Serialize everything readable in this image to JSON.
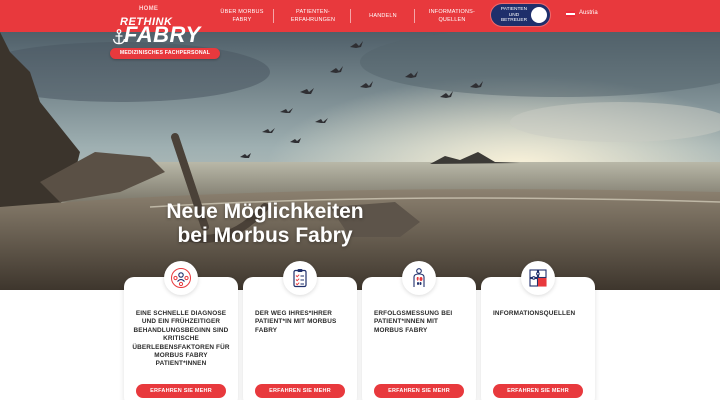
{
  "header": {
    "home_label": "HOME",
    "logo": {
      "top": "RETHINK",
      "main": "FABRY",
      "subtitle": "MEDIZINISCHES FACHPERSONAL"
    },
    "nav": [
      {
        "label": "ÜBER MORBUS\nFABRY"
      },
      {
        "label": "PATIENTEN-\nERFAHRUNGEN"
      },
      {
        "label": "HANDELN"
      },
      {
        "label": "INFORMATIONS-\nQUELLEN"
      }
    ],
    "toggle_label": "PATIENTEN\nUND\nBETREUER",
    "country": "Austria"
  },
  "hero": {
    "title_line1": "Neue Möglichkeiten",
    "title_line2": "bei Morbus Fabry"
  },
  "cards": [
    {
      "icon": "people-network-icon",
      "text": "EINE SCHNELLE DIAGNOSE UND EIN FRÜHZEITIGER BEHANDLUNGSBEGINN SIND KRITISCHE ÜBERLEBENSFAKTOREN FÜR MORBUS FABRY PATIENT*INNEN",
      "button": "ERFAHREN SIE MEHR"
    },
    {
      "icon": "clipboard-checklist-icon",
      "text": "DER WEG IHRES*IHRER PATIENT*IN MIT MORBUS FABRY",
      "button": "ERFAHREN SIE MEHR"
    },
    {
      "icon": "body-organs-icon",
      "text": "ERFOLGSMESSUNG BEI PATIENT*INNEN MIT MORBUS FABRY",
      "button": "ERFAHREN SIE MEHR"
    },
    {
      "icon": "puzzle-icon",
      "text": "INFORMATIONSQUELLEN",
      "button": "ERFAHREN SIE MEHR"
    }
  ],
  "colors": {
    "brand_red": "#e8393d",
    "navy": "#1f2f6b"
  }
}
